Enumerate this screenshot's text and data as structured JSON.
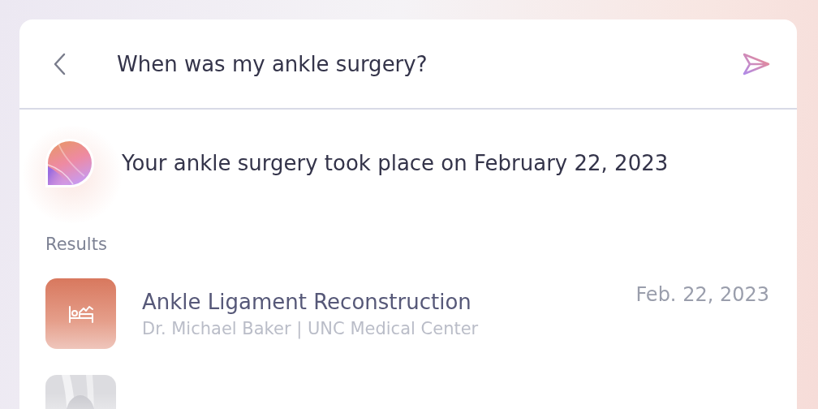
{
  "search": {
    "value": "When was my ankle surgery?"
  },
  "answer": {
    "text": "Your ankle surgery took place on February 22, 2023"
  },
  "results": {
    "heading": "Results",
    "items": [
      {
        "kind": "procedure",
        "title": "Ankle Ligament Reconstruction",
        "subtitle": "Dr. Michael Baker | UNC Medical Center",
        "date": "Feb. 22, 2023"
      },
      {
        "kind": "picture"
      }
    ]
  }
}
